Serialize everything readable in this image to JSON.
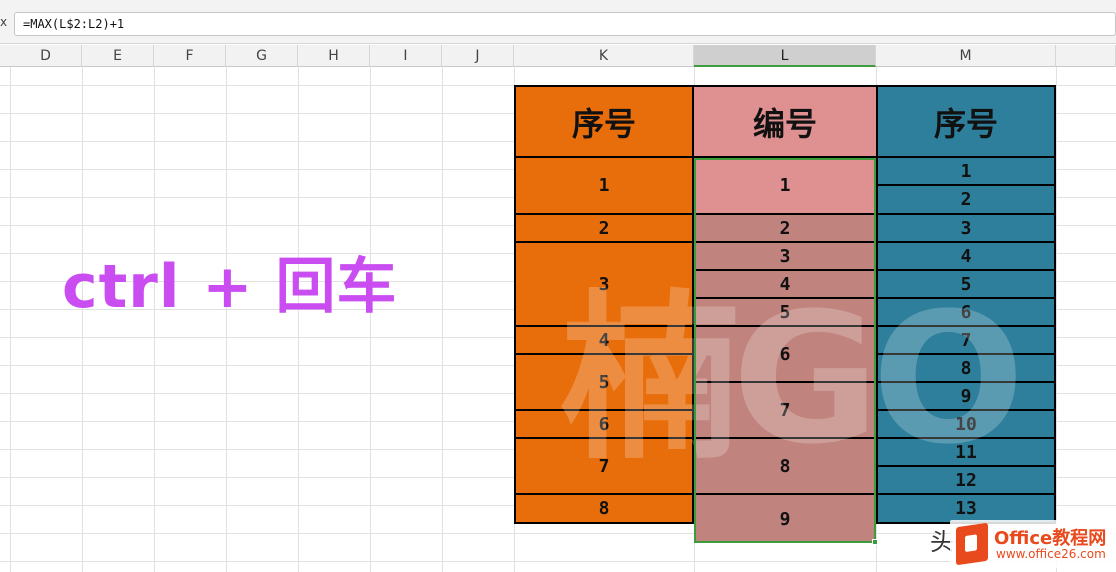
{
  "formula_bar": {
    "fx_label": "x",
    "formula": "=MAX(L$2:L2)+1"
  },
  "columns": [
    "D",
    "E",
    "F",
    "G",
    "H",
    "I",
    "J",
    "K",
    "L",
    "M"
  ],
  "active_column": "L",
  "overlay_text": "ctrl + 回车",
  "watermark": "楠GO",
  "table": {
    "headers": {
      "k": "序号",
      "l": "编号",
      "m": "序号"
    },
    "k_values": [
      "1",
      "2",
      "3",
      "4",
      "5",
      "6",
      "7",
      "8"
    ],
    "l_values": [
      "1",
      "2",
      "3",
      "4",
      "5",
      "6",
      "7",
      "8",
      "9"
    ],
    "m_values": [
      "1",
      "2",
      "3",
      "4",
      "5",
      "6",
      "7",
      "8",
      "9",
      "10",
      "11",
      "12",
      "13"
    ]
  },
  "footer": {
    "prefix": "头条",
    "name": "Office教程网",
    "url": "www.office26.com"
  },
  "colors": {
    "k": "#e86e0c",
    "l": "#c0837d",
    "l_first": "#df9090",
    "m": "#2e7f9b",
    "overlay": "#c94df0",
    "selection": "#3c9c3c"
  }
}
